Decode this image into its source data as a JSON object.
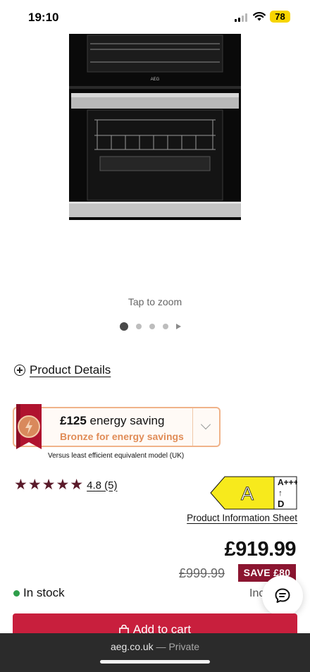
{
  "status_bar": {
    "time": "19:10",
    "battery": "78"
  },
  "product_image": {
    "brand_mark": "AEG",
    "zoom_hint": "Tap to zoom"
  },
  "carousel": {
    "dot_count": 4,
    "active_index": 0
  },
  "product_details": {
    "label": "Product Details"
  },
  "energy": {
    "amount": "£125",
    "amount_suffix": " energy saving",
    "tier": "Bronze for energy savings",
    "note": "Versus least efficient equivalent model (UK)"
  },
  "rating": {
    "stars": "★★★★★",
    "value": "4.8 (5)",
    "star_color": "#5a1a2a"
  },
  "energy_label": {
    "rating": "A",
    "scale_top": "A+++",
    "scale_arrow": "↑",
    "scale_bottom": "D",
    "color": "#f7ea1c"
  },
  "info_sheet": {
    "label": "Product Information Sheet"
  },
  "price": {
    "current": "£919.99",
    "previous": "£999.99",
    "save": "SAVE £80"
  },
  "stock": {
    "status": "In stock",
    "incl": "Inc"
  },
  "cart": {
    "label": "Add to cart",
    "color": "#c81f3d"
  },
  "browser": {
    "domain": "aeg.co.uk",
    "mode": " — Private"
  }
}
